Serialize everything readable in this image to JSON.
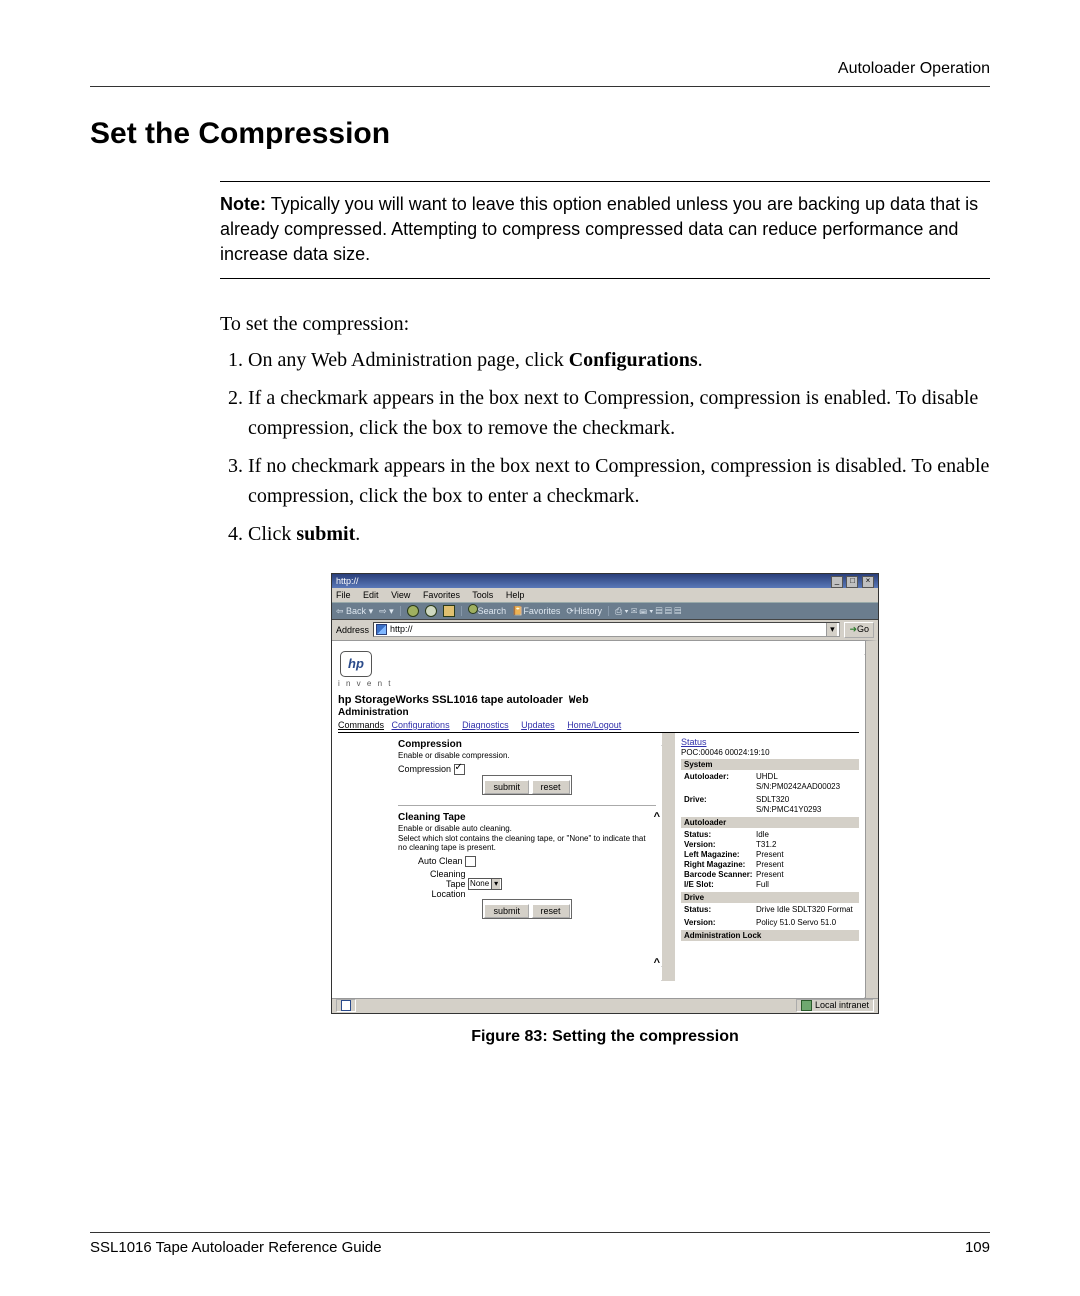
{
  "header": {
    "right": "Autoloader Operation"
  },
  "title": "Set the Compression",
  "note": {
    "label": "Note:",
    "text": "Typically you will want to leave this option enabled unless you are backing up data that is already compressed. Attempting to compress compressed data can reduce performance and increase data size."
  },
  "intro": "To set the compression:",
  "steps": {
    "s1a": "On any Web Administration page, click ",
    "s1b": "Configurations",
    "s1c": ".",
    "s2": "If a checkmark appears in the box next to Compression, compression is enabled. To disable compression, click the box to remove the checkmark.",
    "s3": "If no checkmark appears in the box next to Compression, compression is disabled. To enable compression, click the box to enter a checkmark.",
    "s4a": "Click ",
    "s4b": "submit",
    "s4c": "."
  },
  "figure": {
    "caption": "Figure 83:  Setting the compression"
  },
  "browser": {
    "titlebar": "http://",
    "menu": {
      "file": "File",
      "edit": "Edit",
      "view": "View",
      "favorites": "Favorites",
      "tools": "Tools",
      "help": "Help"
    },
    "toolbar": {
      "back": "Back",
      "search": "Search",
      "favorites": "Favorites",
      "history": "History"
    },
    "address_label": "Address",
    "address_value": "http://",
    "go": "Go",
    "hp_invent": "i n v e n t",
    "app_title_main": "hp StorageWorks SSL1016 tape autoloader",
    "app_title_web": "Web",
    "admin": "Administration",
    "tabs": {
      "commands": "Commands",
      "configurations": "Configurations",
      "diagnostics": "Diagnostics",
      "updates": "Updates",
      "home": "Home/Logout"
    },
    "left": {
      "compression_h": "Compression",
      "compression_sub": "Enable or disable compression.",
      "compression_lbl": "Compression",
      "submit": "submit",
      "reset": "reset",
      "cleaning_h": "Cleaning Tape",
      "cleaning_sub1": "Enable or disable auto cleaning.",
      "cleaning_sub2": "Select which slot contains the cleaning tape, or \"None\" to indicate that no cleaning tape is present.",
      "autoclean": "Auto Clean",
      "clean_tape_loc_a": "Cleaning",
      "clean_tape_loc_b": "Tape",
      "clean_tape_loc_c": "Location",
      "none": "None"
    },
    "right": {
      "status": "Status",
      "poc": "POC:00046 00024:19:10",
      "system": "System",
      "autoloader_k": "Autoloader:",
      "autoloader_v": "UHDL S/N:PM0242AAD00023",
      "drive_k": "Drive:",
      "drive_v": "SDLT320 S/N:PMC41Y0293",
      "autoloader_band": "Autoloader",
      "status_k": "Status:",
      "status_v": "Idle",
      "version_k": "Version:",
      "version_v": "T31.2",
      "leftmag_k": "Left Magazine:",
      "leftmag_v": "Present",
      "rightmag_k": "Right Magazine:",
      "rightmag_v": "Present",
      "barcode_k": "Barcode Scanner:",
      "barcode_v": "Present",
      "ieslot_k": "I/E Slot:",
      "ieslot_v": "Full",
      "drive_band": "Drive",
      "dstatus_k": "Status:",
      "dstatus_v": "Drive Idle SDLT320 Format",
      "dversion_k": "Version:",
      "dversion_v": "Policy 51.0 Servo 51.0",
      "adminlock": "Administration Lock"
    },
    "statusbar": {
      "zone": "Local intranet"
    }
  },
  "footer": {
    "left": "SSL1016 Tape Autoloader Reference Guide",
    "right": "109"
  }
}
